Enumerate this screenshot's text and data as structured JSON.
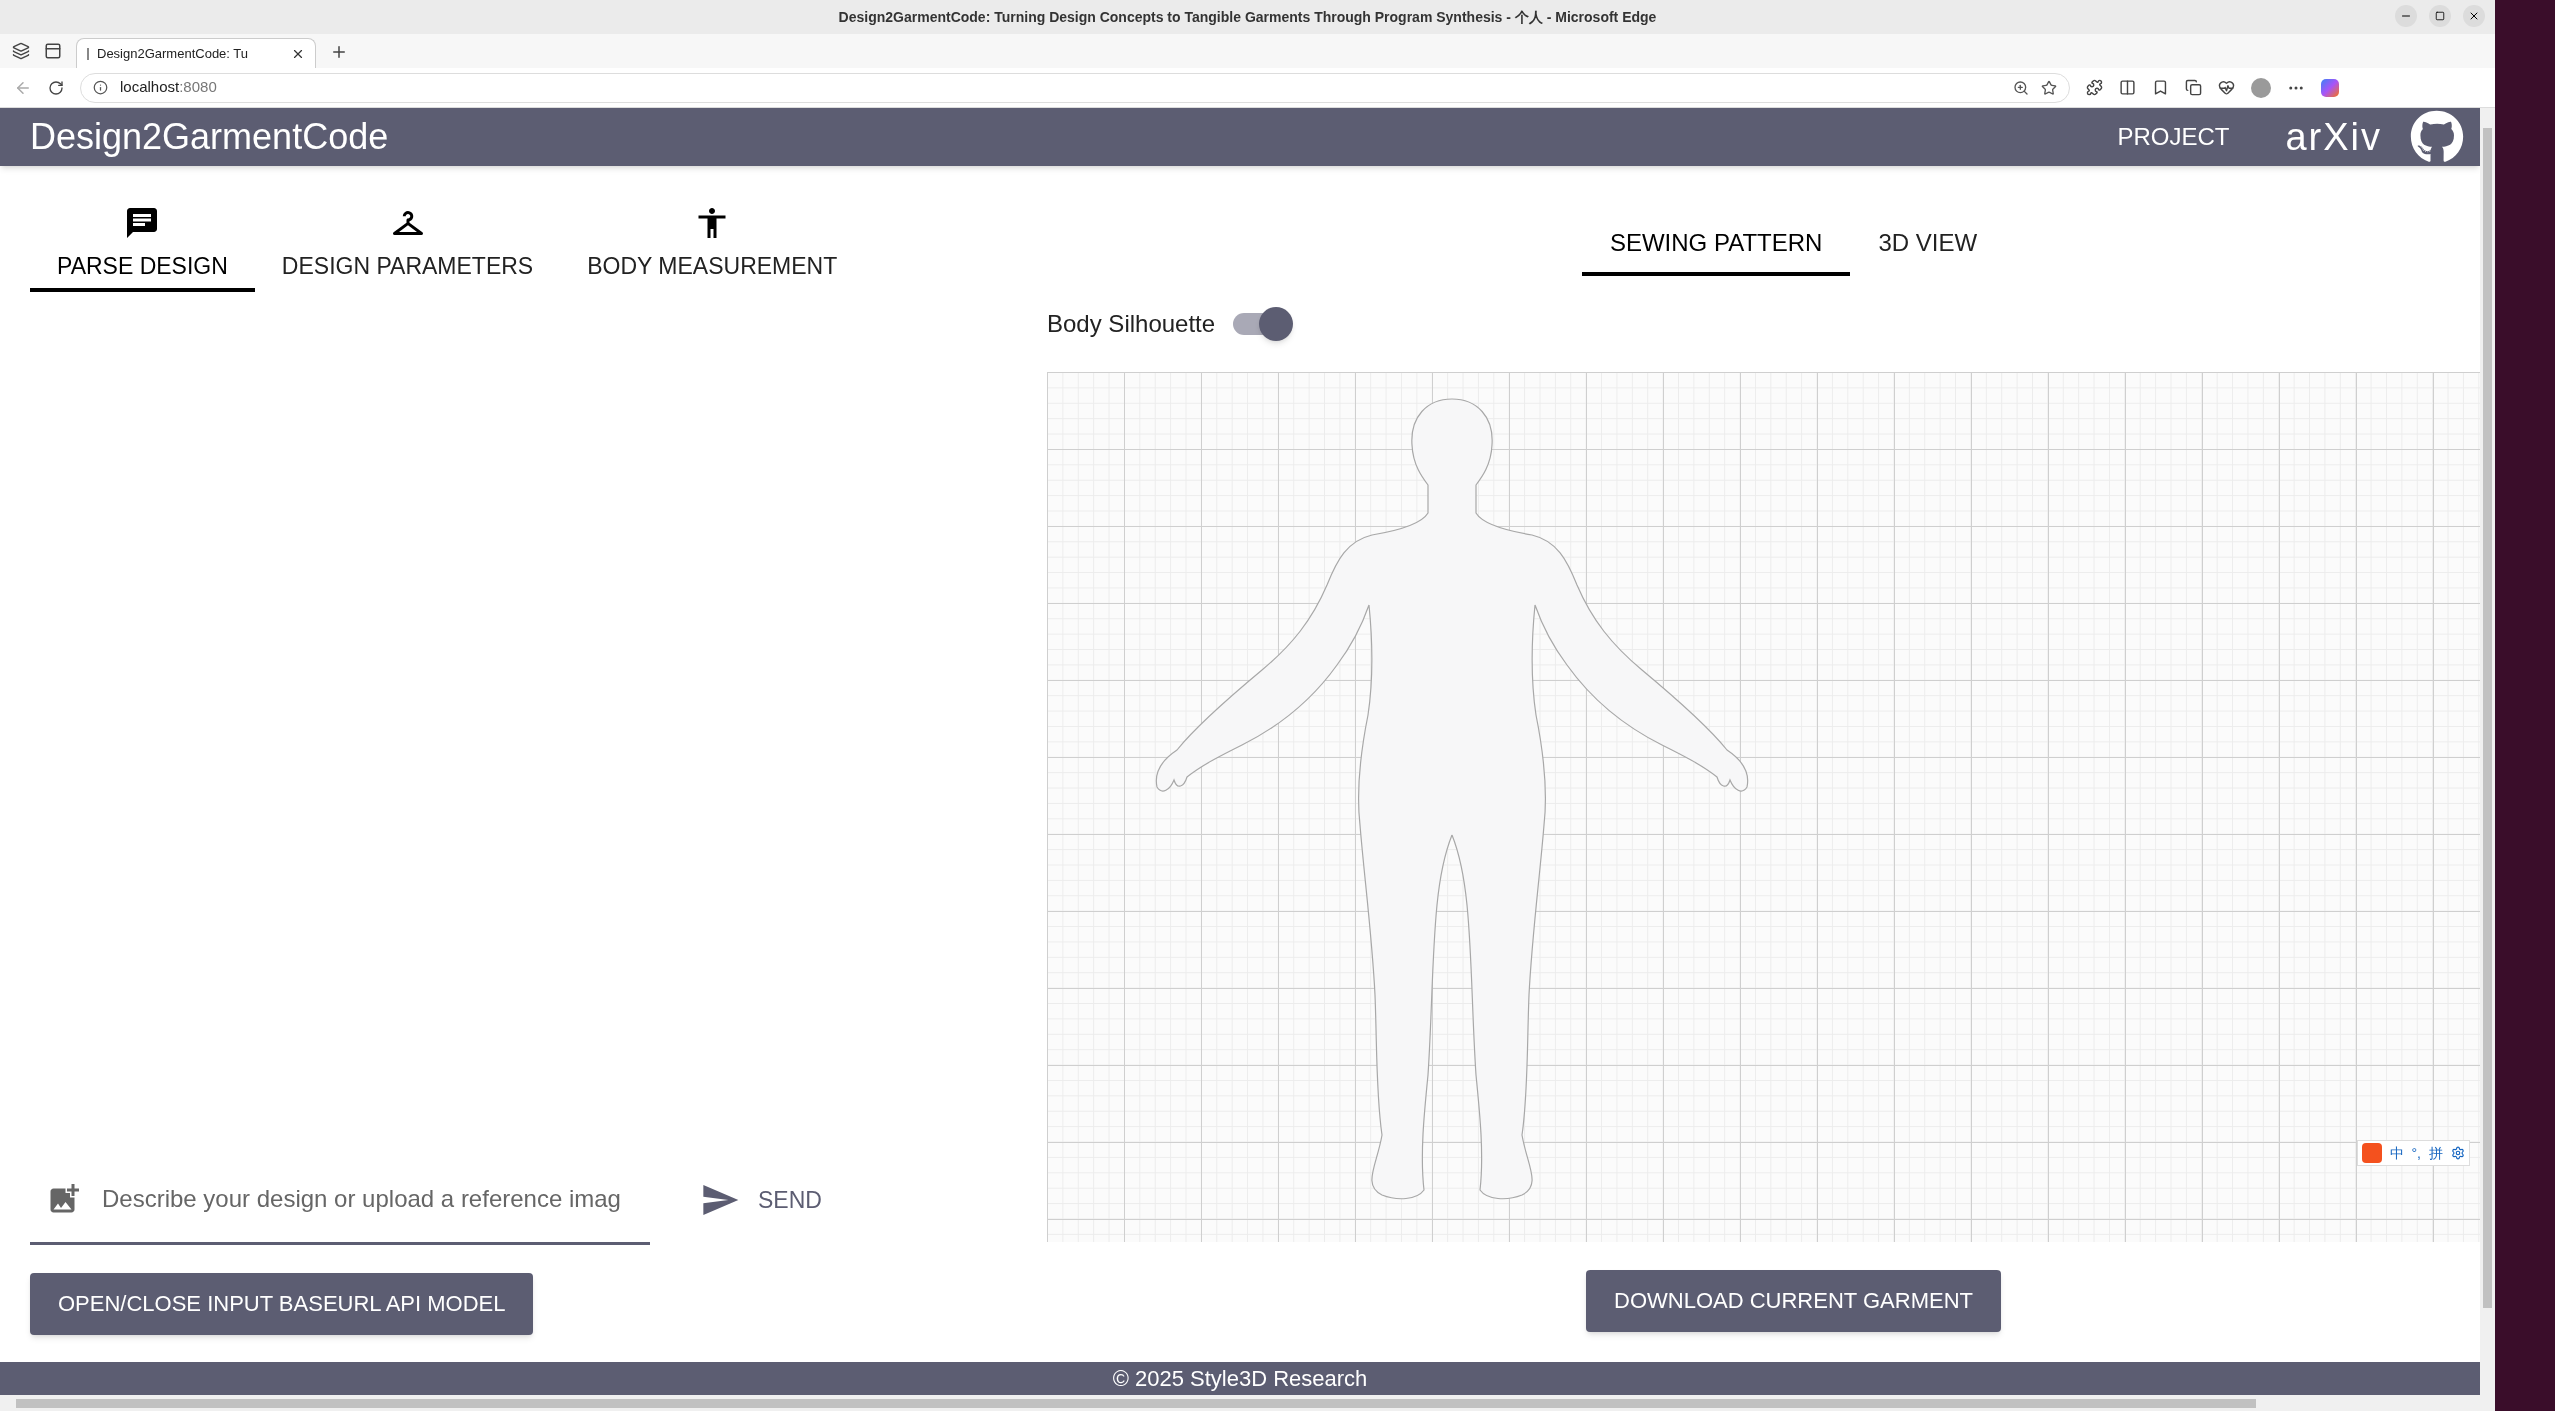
{
  "browser": {
    "window_title": "Design2GarmentCode: Turning Design Concepts to Tangible Garments Through Program Synthesis - 个人 - Microsoft Edge",
    "tab_title": "Design2GarmentCode: Tu",
    "url_host": "localhost",
    "url_port": ":8080"
  },
  "header": {
    "title": "Design2GarmentCode",
    "link": "PROJECT",
    "logo": "arXiv"
  },
  "design_tabs": [
    {
      "label": "PARSE DESIGN",
      "kind": "chat",
      "selected": true
    },
    {
      "label": "DESIGN PARAMETERS",
      "kind": "hanger",
      "selected": false
    },
    {
      "label": "BODY MEASUREMENT",
      "kind": "person",
      "selected": false
    }
  ],
  "view_tabs": [
    {
      "label": "SEWING PATTERN",
      "selected": true
    },
    {
      "label": "3D VIEW",
      "selected": false
    }
  ],
  "silhouette_toggle": {
    "label": "Body Silhouette",
    "on": true
  },
  "chat_input": {
    "placeholder": "Describe your design or upload a reference imag"
  },
  "send_button": "SEND",
  "input_model_button": "OPEN/CLOSE INPUT BASEURL API MODEL",
  "download_button": "DOWNLOAD CURRENT GARMENT",
  "ime_toolbar": [
    "中",
    "°,",
    "拼"
  ],
  "footer": "© 2025 Style3D Research"
}
